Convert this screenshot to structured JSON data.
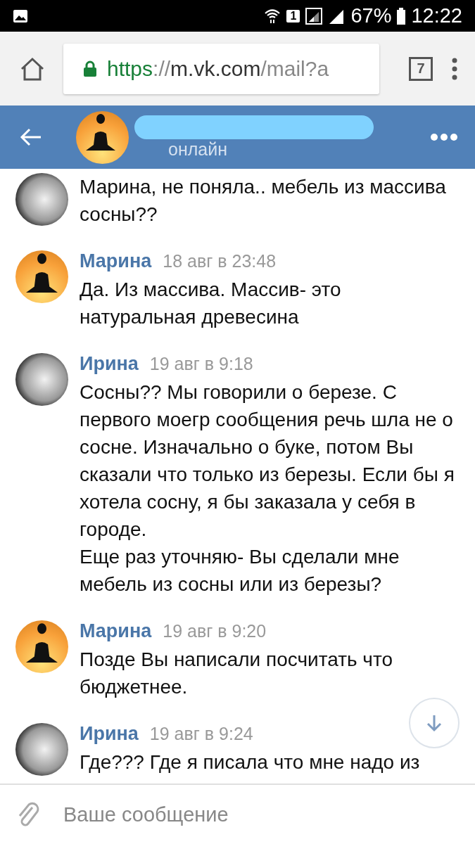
{
  "status_bar": {
    "sim": "1",
    "battery": "67%",
    "time": "12:22"
  },
  "browser": {
    "url": [
      {
        "kind": "scheme",
        "text": "https"
      },
      {
        "kind": "sep",
        "text": "://"
      },
      {
        "kind": "host",
        "text": "m.vk.com"
      },
      {
        "kind": "path",
        "text": "/mail?a"
      }
    ],
    "tab_count": "7"
  },
  "header": {
    "status": "онлайн"
  },
  "messages": [
    {
      "kind": "photo",
      "paragraphs": [
        "Марина, не поняла.. мебель из массива сосны??"
      ]
    },
    {
      "kind": "silhouette",
      "author": "Марина",
      "time": "18 авг в 23:48",
      "paragraphs": [
        "Да. Из массива. Массив- это натуральная древесина"
      ]
    },
    {
      "kind": "photo",
      "author": "Ирина",
      "time": "19 авг в 9:18",
      "paragraphs": [
        "Сосны?? Мы говорили о березе. С первого моегр сообщения речь шла не о сосне. Изначально о буке, потом Вы сказали что только из березы. Если бы я хотела сосну, я бы заказала у себя в городе.",
        "Еще раз уточняю- Вы сделали мне мебель из сосны или из березы?"
      ]
    },
    {
      "kind": "silhouette",
      "author": "Марина",
      "time": "19 авг в 9:20",
      "paragraphs": [
        "Позде Вы написали посчитать что бюджетнее."
      ]
    },
    {
      "kind": "photo",
      "author": "Ирина",
      "time": "19 авг в 9:24",
      "paragraphs": [
        "Где??? Где я писала что мне надо из"
      ]
    }
  ],
  "composer": {
    "placeholder": "Ваше сообщение"
  }
}
